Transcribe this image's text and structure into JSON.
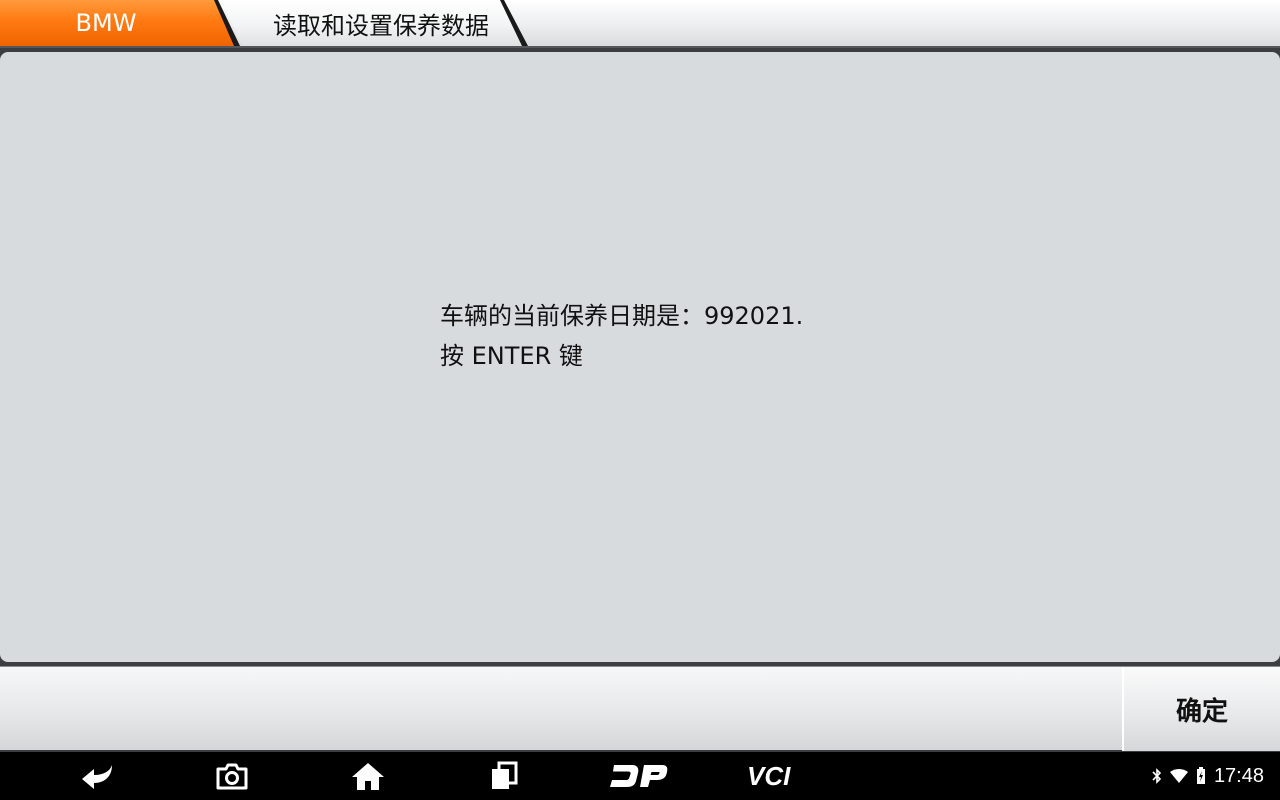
{
  "breadcrumb": {
    "brand": "BMW",
    "page": "读取和设置保养数据"
  },
  "message": {
    "line1": "车辆的当前保养日期是：992021.",
    "line2": "按 ENTER 键"
  },
  "actions": {
    "confirm_label": "确定"
  },
  "navbar": {
    "buttons": [
      {
        "name": "back",
        "icon": "back-arrow-icon"
      },
      {
        "name": "screenshot",
        "icon": "camera-icon"
      },
      {
        "name": "home",
        "icon": "home-icon"
      },
      {
        "name": "recent-apps",
        "icon": "recent-apps-icon"
      },
      {
        "name": "dp",
        "label": "DP"
      },
      {
        "name": "vci",
        "label": "VCI"
      }
    ]
  },
  "status": {
    "time": "17:48",
    "icons": [
      "bluetooth-icon",
      "wifi-icon",
      "battery-charging-icon"
    ]
  },
  "colors": {
    "brand_orange": "#ff7a12",
    "content_bg": "#d8dbde",
    "navbar_bg": "#000000"
  }
}
